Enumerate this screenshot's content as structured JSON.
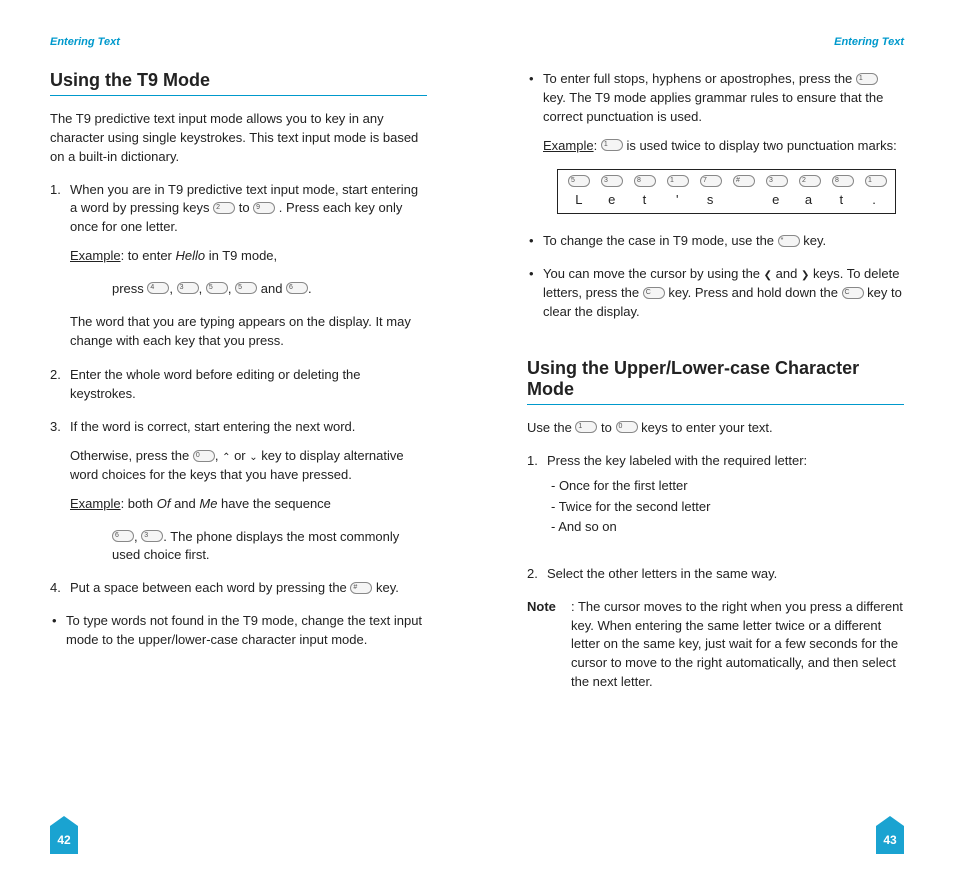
{
  "header": "Entering Text",
  "left": {
    "h2": "Using the T9 Mode",
    "intro": "The T9 predictive text input mode allows you to key in any character using single keystrokes. This text input mode is based on a built-in dictionary.",
    "s1a": "When you are in T9 predictive text input mode, start entering a word by pressing keys ",
    "s1b": " to ",
    "s1c": ". Press each key only once for one letter.",
    "ex1a": "Example",
    "ex1b": ": to enter ",
    "ex1c": "Hello",
    "ex1d": " in T9 mode,",
    "ex1e": "press ",
    "ex1f": " and ",
    "s1g": "The word that you are typing appears on the display. It may change with each key that you press.",
    "s2": "Enter the whole word before editing or deleting the keystrokes.",
    "s3": "If the word is correct, start entering the next word.",
    "s3b1": "Otherwise, press the ",
    "s3b2": " or ",
    "s3b3": " key to display alternative word choices for the keys that you have pressed.",
    "ex2a": "Example",
    "ex2b": ": both ",
    "ex2c": "Of",
    "ex2d": " and ",
    "ex2e": "Me",
    "ex2f": " have the sequence ",
    "ex2g": ". The phone displays the most commonly used choice first.",
    "s4a": "Put a space between each word by pressing the ",
    "s4b": " key.",
    "b1": "To type words not found in the T9 mode, change the text input mode to the upper/lower-case character input mode.",
    "page": "42"
  },
  "right": {
    "b1a": "To enter full stops, hyphens or apostrophes, press the ",
    "b1b": " key. The T9 mode applies grammar rules to ensure that the correct punctuation is used.",
    "ex3a": "Example",
    "ex3b": ": ",
    "ex3c": " is used twice to display two punctuation marks:",
    "letters": [
      "L",
      "e",
      "t",
      "'",
      "s",
      "",
      "e",
      "a",
      "t",
      "."
    ],
    "keys": [
      "5",
      "3",
      "8",
      "1",
      "7",
      "",
      "3",
      "2",
      "8",
      "1"
    ],
    "b2a": "To change the case in T9 mode, use the ",
    "b2b": " key.",
    "b3a": "You can move the cursor by using the ",
    "b3b": " and ",
    "b3c": " keys. To delete letters, press the ",
    "b3d": " key. Press and hold down the ",
    "b3e": " key to clear the display.",
    "h2b": "Using the Upper/Lower-case Character Mode",
    "u1a": "Use the ",
    "u1b": " to ",
    "u1c": " keys to enter your text.",
    "u2": "Press the key labeled with the required letter:",
    "d1": "- Once for the first letter",
    "d2": "- Twice for the second letter",
    "d3": "- And so on",
    "u3": "Select the other letters in the same way.",
    "noteL": "Note",
    "note": ": The cursor moves to the right when you press a different key. When entering the same letter twice or a different letter on the same key, just wait for a few seconds for the cursor to move to the right automatically, and then select the next letter.",
    "page": "43"
  }
}
